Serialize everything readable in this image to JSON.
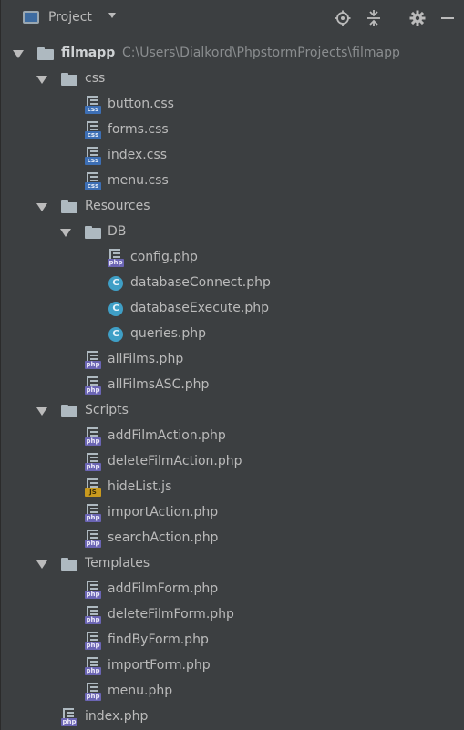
{
  "header": {
    "title": "Project",
    "icons": [
      "project-view-icon",
      "dropdown-arrow-icon",
      "locate-crosshair-icon",
      "collapse-all-icon",
      "gear-icon",
      "minimize-icon"
    ]
  },
  "tree": {
    "root": {
      "name": "filmapp",
      "path": "C:\\Users\\Dialkord\\PhpstormProjects\\filmapp"
    },
    "css": {
      "name": "css",
      "files": [
        "button.css",
        "forms.css",
        "index.css",
        "menu.css"
      ]
    },
    "resources": {
      "name": "Resources",
      "db": {
        "name": "DB",
        "files": [
          "config.php",
          "databaseConnect.php",
          "databaseExecute.php",
          "queries.php"
        ]
      },
      "files": [
        "allFilms.php",
        "allFilmsASC.php"
      ]
    },
    "scripts": {
      "name": "Scripts",
      "files": [
        "addFilmAction.php",
        "deleteFilmAction.php",
        "hideList.js",
        "importAction.php",
        "searchAction.php"
      ]
    },
    "templates": {
      "name": "Templates",
      "files": [
        "addFilmForm.php",
        "deleteFilmForm.php",
        "findByForm.php",
        "importForm.php",
        "menu.php"
      ]
    },
    "root_files": [
      "index.php"
    ]
  },
  "colors": {
    "background": "#3c3f41",
    "text": "#bbbbbb",
    "path_text": "#8a8d8f",
    "css_badge": "#3d6fb5",
    "php_badge": "#6b65b4",
    "js_badge": "#c99a1e",
    "class_icon": "#3f9fc6"
  }
}
